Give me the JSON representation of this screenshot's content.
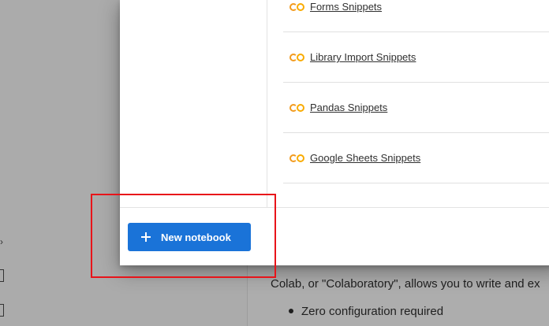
{
  "background": {
    "intro_text": "Colab, or \"Colaboratory\", allows you to write and ex",
    "bullet_text": "Zero configuration required",
    "side_icons": [
      "chevron-right-icon",
      "bracket-icon",
      "bracket-icon"
    ]
  },
  "dialog": {
    "snippets": [
      {
        "label": "Forms Snippets",
        "icon": "colab-icon"
      },
      {
        "label": "Library Import Snippets",
        "icon": "colab-icon"
      },
      {
        "label": "Pandas Snippets",
        "icon": "colab-icon"
      },
      {
        "label": "Google Sheets Snippets",
        "icon": "colab-icon"
      }
    ],
    "new_notebook_label": "New notebook"
  },
  "colors": {
    "accent": "#1a73d8",
    "colab_orange": "#f9ab00",
    "highlight": "#e8141a"
  }
}
